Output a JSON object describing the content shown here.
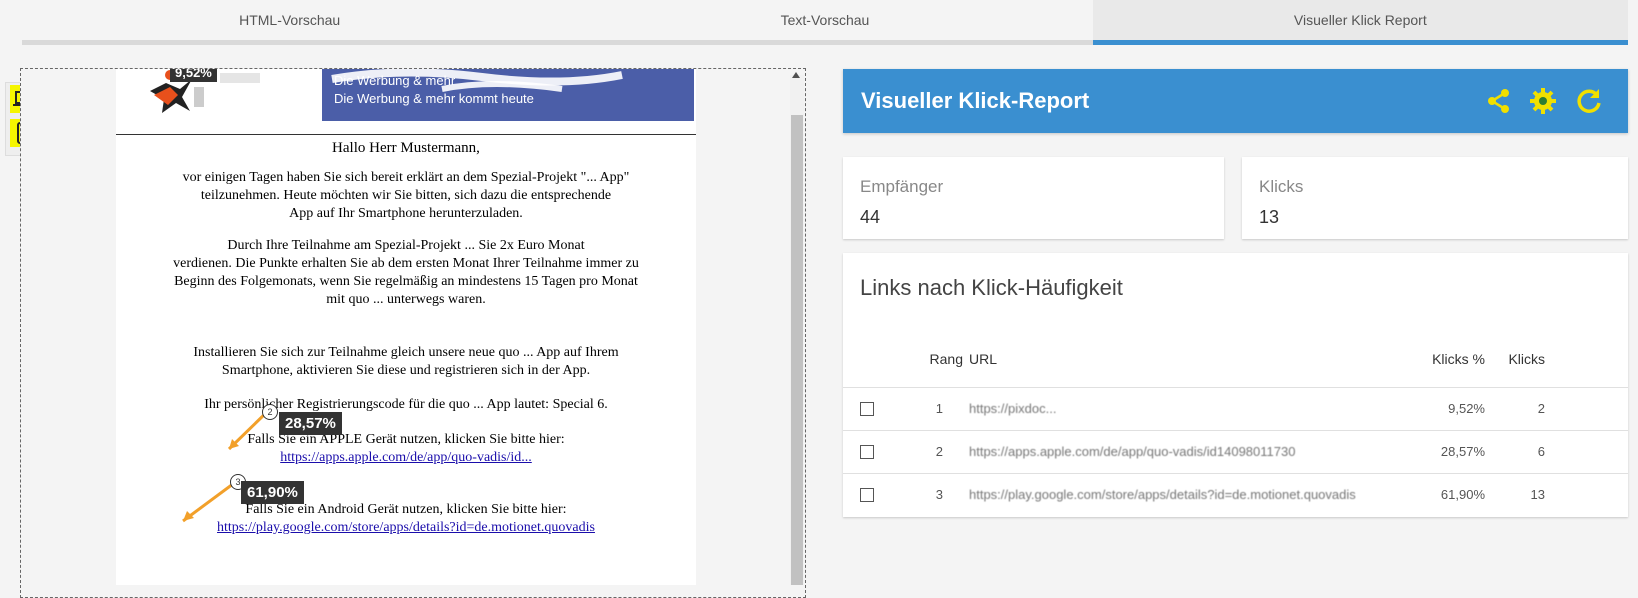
{
  "tabs": [
    {
      "label": "HTML-Vorschau"
    },
    {
      "label": "Text-Vorschau"
    },
    {
      "label": "Visueller Klick Report"
    }
  ],
  "preview": {
    "badge_top": "9,52%",
    "banner_line1": "Die Werbung & mehr",
    "banner_line2": "Die Werbung & mehr kommt heute",
    "greeting": "Hallo Herr Mustermann,",
    "para1_l1": "vor einigen Tagen haben Sie sich bereit erklärt an dem Spezial-Projekt \"... App\"",
    "para1_l2": "teilzunehmen. Heute möchten wir Sie bitten, sich dazu die entsprechende",
    "para1_l3": "App auf Ihr Smartphone herunterzuladen.",
    "para2_l1": "Durch Ihre Teilnahme am Spezial-Projekt ... Sie 2x Euro Monat",
    "para2_l2": "verdienen. Die Punkte erhalten Sie ab dem ersten Monat Ihrer Teilnahme immer zu",
    "para2_l3": "Beginn des Folgemonats, wenn Sie regelmäßig an mindestens 15 Tagen pro Monat",
    "para2_l4": "mit quo ... unterwegs waren.",
    "para3_l1": "Installieren Sie sich zur Teilnahme gleich unsere neue quo ... App auf Ihrem",
    "para3_l2": "Smartphone, aktivieren Sie diese und registrieren sich in der App.",
    "para4": "Ihr persönlicher Registrierungscode für die quo ... App lautet: Special 6.",
    "apple_text": "Falls Sie ein APPLE Gerät nutzen, klicken Sie bitte hier:",
    "apple_link": "https://apps.apple.com/de/app/quo-vadis/id...",
    "android_text": "Falls Sie ein Android Gerät nutzen, klicken Sie bitte hier:",
    "android_link": "https://play.google.com/store/apps/details?id=de.motionet.quovadis",
    "badge2_num": "2",
    "badge2_pct": "28,57%",
    "badge3_num": "3",
    "badge3_pct": "61,90%"
  },
  "report": {
    "title": "Visueller Klick-Report",
    "recipients_label": "Empfänger",
    "recipients_value": "44",
    "clicks_label": "Klicks",
    "clicks_value": "13",
    "links_title": "Links nach Klick-Häufigkeit",
    "columns": {
      "rank": "Rang",
      "url": "URL",
      "clicks_pct": "Klicks %",
      "clicks": "Klicks"
    },
    "rows": [
      {
        "rank": "1",
        "url": "https://pixdoc...",
        "pct": "9,52%",
        "clicks": "2"
      },
      {
        "rank": "2",
        "url": "https://apps.apple.com/de/app/quo-vadis/id14098011730",
        "pct": "28,57%",
        "clicks": "6"
      },
      {
        "rank": "3",
        "url": "https://play.google.com/store/apps/details?id=de.motionet.quovadis",
        "pct": "61,90%",
        "clicks": "13"
      }
    ]
  }
}
